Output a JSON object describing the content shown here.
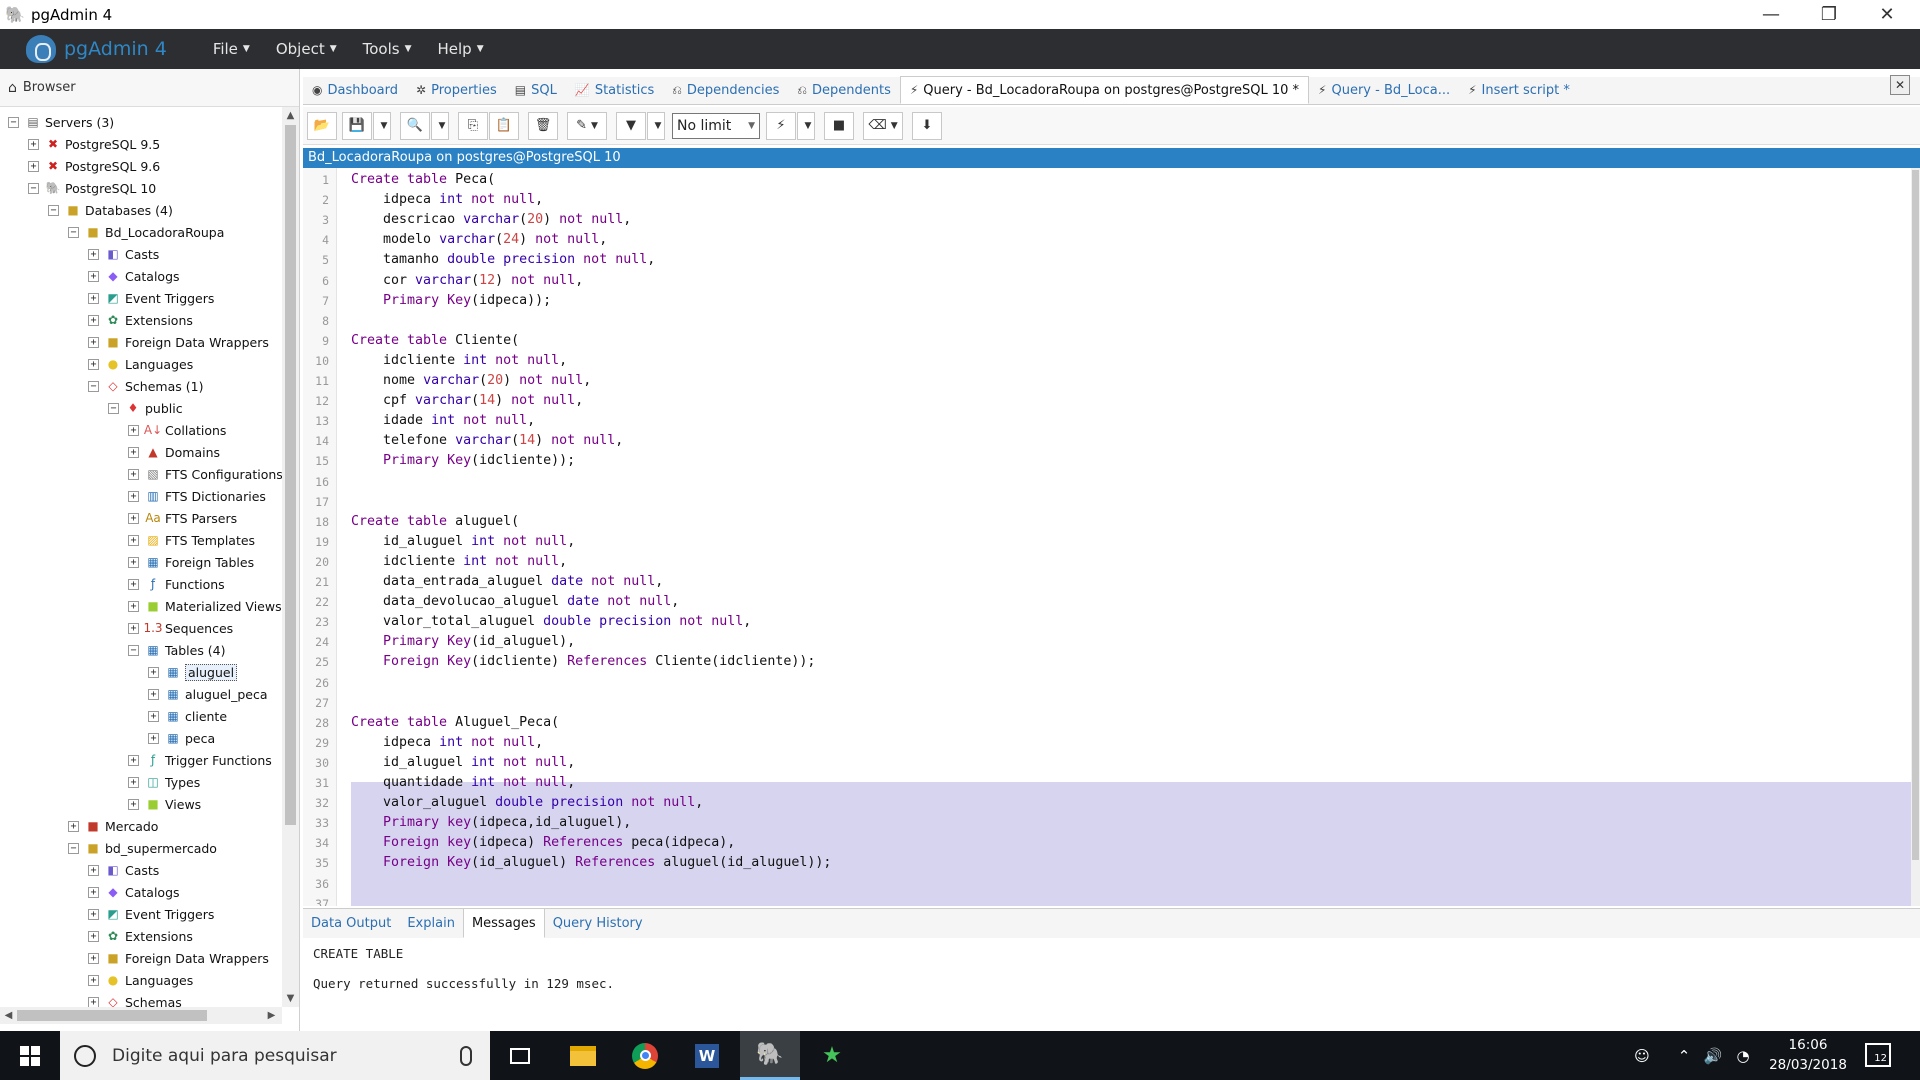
{
  "window": {
    "title": "pgAdmin 4"
  },
  "menubar": {
    "brand": "pgAdmin 4",
    "menus": [
      "File",
      "Object",
      "Tools",
      "Help"
    ]
  },
  "browser": {
    "title": "Browser",
    "tree": [
      {
        "label": "Servers (3)",
        "level": 0,
        "tog": "-",
        "icon": "▤",
        "color": "#666"
      },
      {
        "label": "PostgreSQL 9.5",
        "level": 1,
        "tog": "+",
        "icon": "✖",
        "color": "#c22"
      },
      {
        "label": "PostgreSQL 9.6",
        "level": 1,
        "tog": "+",
        "icon": "✖",
        "color": "#c22"
      },
      {
        "label": "PostgreSQL 10",
        "level": 1,
        "tog": "-",
        "icon": "🐘",
        "color": "#336791"
      },
      {
        "label": "Databases (4)",
        "level": 2,
        "tog": "-",
        "icon": "■",
        "color": "#c9a227"
      },
      {
        "label": "Bd_LocadoraRoupa",
        "level": 3,
        "tog": "-",
        "icon": "■",
        "color": "#c9a227"
      },
      {
        "label": "Casts",
        "level": 4,
        "tog": "+",
        "icon": "◧",
        "color": "#6a5acd"
      },
      {
        "label": "Catalogs",
        "level": 4,
        "tog": "+",
        "icon": "◆",
        "color": "#8b5cf6"
      },
      {
        "label": "Event Triggers",
        "level": 4,
        "tog": "+",
        "icon": "◩",
        "color": "#2a9d8f"
      },
      {
        "label": "Extensions",
        "level": 4,
        "tog": "+",
        "icon": "✿",
        "color": "#2e8b57"
      },
      {
        "label": "Foreign Data Wrappers",
        "level": 4,
        "tog": "+",
        "icon": "■",
        "color": "#c9a227"
      },
      {
        "label": "Languages",
        "level": 4,
        "tog": "+",
        "icon": "●",
        "color": "#e6c229"
      },
      {
        "label": "Schemas (1)",
        "level": 4,
        "tog": "-",
        "icon": "◇",
        "color": "#d33"
      },
      {
        "label": "public",
        "level": 5,
        "tog": "-",
        "icon": "♦",
        "color": "#d33"
      },
      {
        "label": "Collations",
        "level": 6,
        "tog": "+",
        "icon": "A↓",
        "color": "#d55"
      },
      {
        "label": "Domains",
        "level": 6,
        "tog": "+",
        "icon": "▲",
        "color": "#c0392b"
      },
      {
        "label": "FTS Configurations",
        "level": 6,
        "tog": "+",
        "icon": "▧",
        "color": "#777"
      },
      {
        "label": "FTS Dictionaries",
        "level": 6,
        "tog": "+",
        "icon": "▥",
        "color": "#2a6fb3"
      },
      {
        "label": "FTS Parsers",
        "level": 6,
        "tog": "+",
        "icon": "Aa",
        "color": "#b8860b"
      },
      {
        "label": "FTS Templates",
        "level": 6,
        "tog": "+",
        "icon": "▨",
        "color": "#e6a800"
      },
      {
        "label": "Foreign Tables",
        "level": 6,
        "tog": "+",
        "icon": "▦",
        "color": "#2a6fb3"
      },
      {
        "label": "Functions",
        "level": 6,
        "tog": "+",
        "icon": "ƒ",
        "color": "#2a6fb3"
      },
      {
        "label": "Materialized Views",
        "level": 6,
        "tog": "+",
        "icon": "■",
        "color": "#9acd32"
      },
      {
        "label": "Sequences",
        "level": 6,
        "tog": "+",
        "icon": "1.3",
        "color": "#c0392b"
      },
      {
        "label": "Tables (4)",
        "level": 6,
        "tog": "-",
        "icon": "▦",
        "color": "#2a6fb3"
      },
      {
        "label": "aluguel",
        "level": 7,
        "tog": "+",
        "icon": "▦",
        "color": "#2a6fb3",
        "selected": true
      },
      {
        "label": "aluguel_peca",
        "level": 7,
        "tog": "+",
        "icon": "▦",
        "color": "#2a6fb3"
      },
      {
        "label": "cliente",
        "level": 7,
        "tog": "+",
        "icon": "▦",
        "color": "#2a6fb3"
      },
      {
        "label": "peca",
        "level": 7,
        "tog": "+",
        "icon": "▦",
        "color": "#2a6fb3"
      },
      {
        "label": "Trigger Functions",
        "level": 6,
        "tog": "+",
        "icon": "ƒ",
        "color": "#2a9d8f"
      },
      {
        "label": "Types",
        "level": 6,
        "tog": "+",
        "icon": "◫",
        "color": "#2a9d8f"
      },
      {
        "label": "Views",
        "level": 6,
        "tog": "+",
        "icon": "■",
        "color": "#9acd32"
      },
      {
        "label": "Mercado",
        "level": 3,
        "tog": "+",
        "icon": "■",
        "color": "#c0392b"
      },
      {
        "label": "bd_supermercado",
        "level": 3,
        "tog": "-",
        "icon": "■",
        "color": "#c9a227"
      },
      {
        "label": "Casts",
        "level": 4,
        "tog": "+",
        "icon": "◧",
        "color": "#6a5acd"
      },
      {
        "label": "Catalogs",
        "level": 4,
        "tog": "+",
        "icon": "◆",
        "color": "#8b5cf6"
      },
      {
        "label": "Event Triggers",
        "level": 4,
        "tog": "+",
        "icon": "◩",
        "color": "#2a9d8f"
      },
      {
        "label": "Extensions",
        "level": 4,
        "tog": "+",
        "icon": "✿",
        "color": "#2e8b57"
      },
      {
        "label": "Foreign Data Wrappers",
        "level": 4,
        "tog": "+",
        "icon": "■",
        "color": "#c9a227"
      },
      {
        "label": "Languages",
        "level": 4,
        "tog": "+",
        "icon": "●",
        "color": "#e6c229"
      },
      {
        "label": "Schemas",
        "level": 4,
        "tog": "+",
        "icon": "◇",
        "color": "#d33"
      }
    ]
  },
  "tabs": [
    {
      "label": "Dashboard",
      "icon": "◉",
      "active": false
    },
    {
      "label": "Properties",
      "icon": "✲",
      "active": false
    },
    {
      "label": "SQL",
      "icon": "▤",
      "active": false
    },
    {
      "label": "Statistics",
      "icon": "📈",
      "active": false
    },
    {
      "label": "Dependencies",
      "icon": "⎌",
      "active": false
    },
    {
      "label": "Dependents",
      "icon": "⎌",
      "active": false
    },
    {
      "label": "Query - Bd_LocadoraRoupa on postgres@PostgreSQL 10 *",
      "icon": "⚡",
      "active": true
    },
    {
      "label": "Query - Bd_Loca...",
      "icon": "⚡",
      "active": false
    },
    {
      "label": "Insert script *",
      "icon": "⚡",
      "active": false
    }
  ],
  "toolbar": {
    "limit": "No limit"
  },
  "connection": {
    "label": "Bd_LocadoraRoupa on postgres@PostgreSQL 10"
  },
  "editor": {
    "lines": [
      [
        [
          "kw",
          "Create table "
        ],
        [
          "",
          "Peca("
        ]
      ],
      [
        [
          "",
          "    idpeca "
        ],
        [
          "ty",
          "int"
        ],
        [
          "kw",
          " not null"
        ],
        [
          "",
          ","
        ]
      ],
      [
        [
          "",
          "    descricao "
        ],
        [
          "ty",
          "varchar"
        ],
        [
          "",
          "("
        ],
        [
          "nm",
          "20"
        ],
        [
          "",
          ") "
        ],
        [
          "kw",
          "not null"
        ],
        [
          "",
          ","
        ]
      ],
      [
        [
          "",
          "    modelo "
        ],
        [
          "ty",
          "varchar"
        ],
        [
          "",
          "("
        ],
        [
          "nm",
          "24"
        ],
        [
          "",
          ") "
        ],
        [
          "kw",
          "not null"
        ],
        [
          "",
          ","
        ]
      ],
      [
        [
          "",
          "    tamanho "
        ],
        [
          "ty",
          "double precision"
        ],
        [
          "kw",
          " not null"
        ],
        [
          "",
          ","
        ]
      ],
      [
        [
          "",
          "    cor "
        ],
        [
          "ty",
          "varchar"
        ],
        [
          "",
          "("
        ],
        [
          "nm",
          "12"
        ],
        [
          "",
          ") "
        ],
        [
          "kw",
          "not null"
        ],
        [
          "",
          ","
        ]
      ],
      [
        [
          "",
          "    "
        ],
        [
          "kw",
          "Primary Key"
        ],
        [
          "",
          "(idpeca));"
        ]
      ],
      [],
      [
        [
          "kw",
          "Create table "
        ],
        [
          "",
          "Cliente("
        ]
      ],
      [
        [
          "",
          "    idcliente "
        ],
        [
          "ty",
          "int"
        ],
        [
          "kw",
          " not null"
        ],
        [
          "",
          ","
        ]
      ],
      [
        [
          "",
          "    nome "
        ],
        [
          "ty",
          "varchar"
        ],
        [
          "",
          "("
        ],
        [
          "nm",
          "20"
        ],
        [
          "",
          ") "
        ],
        [
          "kw",
          "not null"
        ],
        [
          "",
          ","
        ]
      ],
      [
        [
          "",
          "    cpf "
        ],
        [
          "ty",
          "varchar"
        ],
        [
          "",
          "("
        ],
        [
          "nm",
          "14"
        ],
        [
          "",
          ") "
        ],
        [
          "kw",
          "not null"
        ],
        [
          "",
          ","
        ]
      ],
      [
        [
          "",
          "    idade "
        ],
        [
          "ty",
          "int"
        ],
        [
          "kw",
          " not null"
        ],
        [
          "",
          ","
        ]
      ],
      [
        [
          "",
          "    telefone "
        ],
        [
          "ty",
          "varchar"
        ],
        [
          "",
          "("
        ],
        [
          "nm",
          "14"
        ],
        [
          "",
          ") "
        ],
        [
          "kw",
          "not null"
        ],
        [
          "",
          ","
        ]
      ],
      [
        [
          "",
          "    "
        ],
        [
          "kw",
          "Primary Key"
        ],
        [
          "",
          "(idcliente));"
        ]
      ],
      [],
      [],
      [
        [
          "kw",
          "Create table "
        ],
        [
          "",
          "aluguel("
        ]
      ],
      [
        [
          "",
          "    id_aluguel "
        ],
        [
          "ty",
          "int"
        ],
        [
          "kw",
          " not null"
        ],
        [
          "",
          ","
        ]
      ],
      [
        [
          "",
          "    idcliente "
        ],
        [
          "ty",
          "int"
        ],
        [
          "kw",
          " not null"
        ],
        [
          "",
          ","
        ]
      ],
      [
        [
          "",
          "    data_entrada_aluguel "
        ],
        [
          "ty",
          "date"
        ],
        [
          "kw",
          " not null"
        ],
        [
          "",
          ","
        ]
      ],
      [
        [
          "",
          "    data_devolucao_aluguel "
        ],
        [
          "ty",
          "date"
        ],
        [
          "kw",
          " not null"
        ],
        [
          "",
          ","
        ]
      ],
      [
        [
          "",
          "    valor_total_aluguel "
        ],
        [
          "ty",
          "double precision"
        ],
        [
          "kw",
          " not null"
        ],
        [
          "",
          ","
        ]
      ],
      [
        [
          "",
          "    "
        ],
        [
          "kw",
          "Primary Key"
        ],
        [
          "",
          "(id_aluguel),"
        ]
      ],
      [
        [
          "",
          "    "
        ],
        [
          "kw",
          "Foreign Key"
        ],
        [
          "",
          "(idcliente) "
        ],
        [
          "kw",
          "References"
        ],
        [
          "",
          " Cliente(idcliente));"
        ]
      ],
      [],
      [],
      [
        [
          "kw",
          "Create table "
        ],
        [
          "",
          "Aluguel_Peca("
        ]
      ],
      [
        [
          "",
          "    idpeca "
        ],
        [
          "ty",
          "int"
        ],
        [
          "kw",
          " not null"
        ],
        [
          "",
          ","
        ]
      ],
      [
        [
          "",
          "    id_aluguel "
        ],
        [
          "ty",
          "int"
        ],
        [
          "kw",
          " not null"
        ],
        [
          "",
          ","
        ]
      ],
      [
        [
          "",
          "    quantidade "
        ],
        [
          "ty",
          "int"
        ],
        [
          "kw",
          " not null"
        ],
        [
          "",
          ","
        ]
      ],
      [
        [
          "",
          "    valor_aluguel "
        ],
        [
          "ty",
          "double precision"
        ],
        [
          "kw",
          " not null"
        ],
        [
          "",
          ","
        ]
      ],
      [
        [
          "",
          "    "
        ],
        [
          "kw",
          "Primary key"
        ],
        [
          "",
          "(idpeca,id_aluguel),"
        ]
      ],
      [
        [
          "",
          "    "
        ],
        [
          "kw",
          "Foreign key"
        ],
        [
          "",
          "(idpeca) "
        ],
        [
          "kw",
          "References"
        ],
        [
          "",
          " peca(idpeca),"
        ]
      ],
      [
        [
          "",
          "    "
        ],
        [
          "kw",
          "Foreign Key"
        ],
        [
          "",
          "(id_aluguel) "
        ],
        [
          "kw",
          "References"
        ],
        [
          "",
          " aluguel(id_aluguel));"
        ]
      ],
      [],
      []
    ]
  },
  "results": {
    "tabs": [
      {
        "label": "Data Output",
        "active": false
      },
      {
        "label": "Explain",
        "active": false
      },
      {
        "label": "Messages",
        "active": true
      },
      {
        "label": "Query History",
        "active": false
      }
    ],
    "message1": "CREATE TABLE",
    "message2": "Query returned successfully in 129 msec."
  },
  "taskbar": {
    "search_placeholder": "Digite aqui para pesquisar",
    "time": "16:06",
    "date": "28/03/2018",
    "notifications": "12"
  }
}
